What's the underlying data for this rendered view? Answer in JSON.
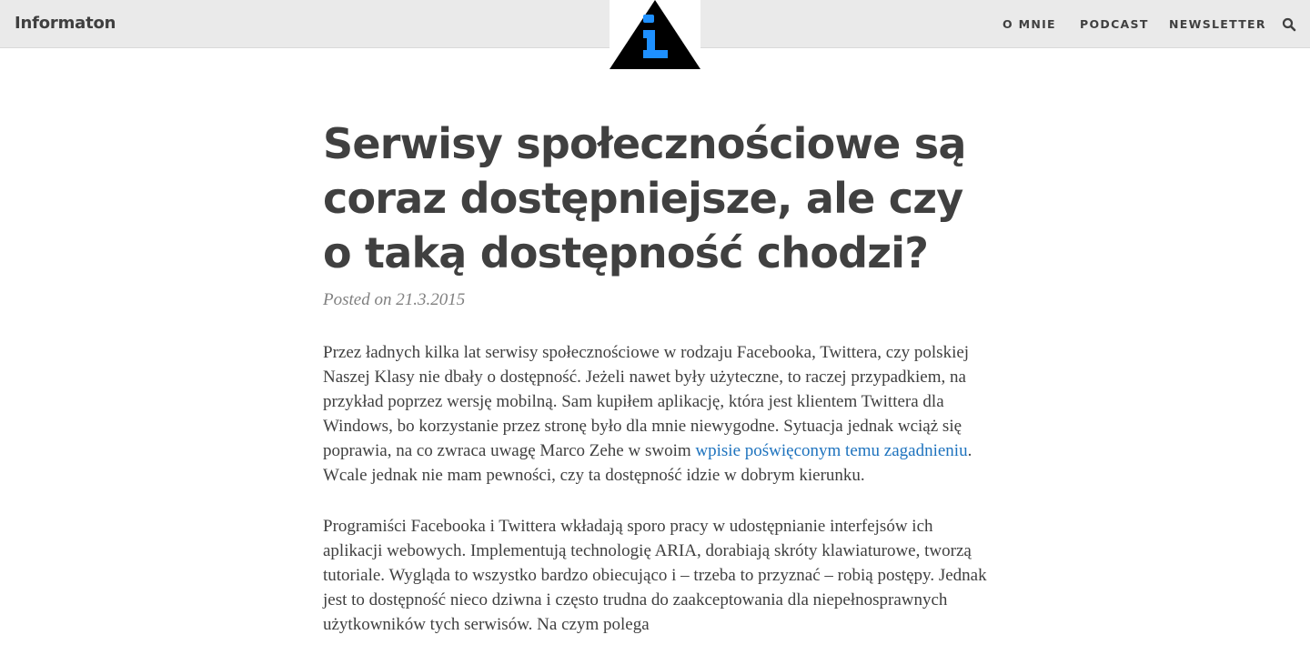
{
  "site": {
    "name": "Informaton"
  },
  "nav": {
    "items": [
      {
        "label": "O MNIE"
      },
      {
        "label": "PODCAST"
      },
      {
        "label": "NEWSLETTER"
      }
    ],
    "search_icon": "search-icon"
  },
  "logo": {
    "icon": "info-triangle-logo",
    "colors": {
      "triangle": "#000000",
      "glyph": "#1e90ff"
    }
  },
  "article": {
    "title": "Serwisy społecznościowe są coraz dostępniejsze, ale czy o taką dostępność chodzi?",
    "meta_prefix": "Posted on",
    "date": "21.3.2015",
    "paragraph1": {
      "before_link": "Przez ładnych kilka lat serwisy społecznościowe w rodzaju Facebooka, Twittera, czy polskiej Naszej Klasy nie dbały o dostępność. Jeżeli nawet były użyteczne, to raczej przypadkiem, na przykład poprzez wersję mobilną. Sam kupiłem aplikację, która jest klientem Twittera dla Windows, bo korzystanie przez stronę było dla mnie niewygodne. Sytuacja jednak wciąż się poprawia, na co zwraca uwagę Marco Zehe w swoim ",
      "link_text": "wpisie poświęconym temu zagadnieniu",
      "after_link": ". Wcale jednak nie mam pewności, czy ta dostępność idzie w dobrym kierunku."
    },
    "paragraph2": "Programiści Facebooka i Twittera wkładają sporo pracy w udostępnianie interfejsów ich aplikacji webowych. Implementują technologię ARIA, dorabiają skróty klawiaturowe, tworzą tutoriale. Wygląda to wszystko bardzo obiecująco i – trzeba to przyznać – robią postępy. Jednak jest to dostępność nieco dziwna i często trudna do zaakceptowania dla niepełnosprawnych użytkowników tych serwisów. Na czym polega"
  },
  "colors": {
    "topbar": "#eaeaea",
    "text": "#404040",
    "meta": "#808080",
    "link": "#1e73be"
  }
}
